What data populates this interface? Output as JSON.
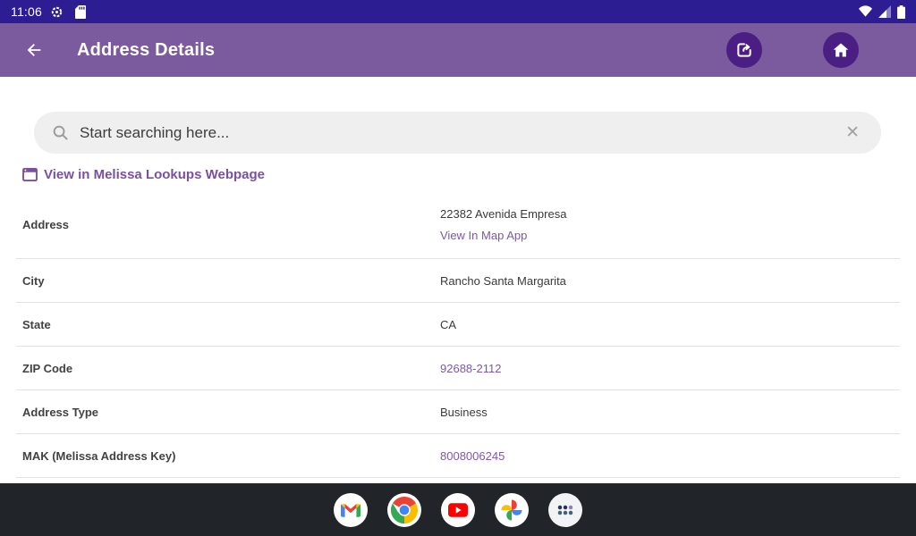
{
  "status_bar": {
    "time": "11:06",
    "left_icons": [
      "gear-icon",
      "sdcard-icon"
    ],
    "right_icons": [
      "wifi-icon",
      "cell-signal-icon",
      "battery-icon"
    ]
  },
  "app_bar": {
    "title": "Address Details",
    "actions": [
      "share",
      "home"
    ]
  },
  "search": {
    "placeholder": "Start searching here...",
    "value": ""
  },
  "webpage_link": {
    "label": "View in Melissa Lookups Webpage"
  },
  "details": {
    "rows": [
      {
        "label": "Address",
        "value": "22382 Avenida Empresa",
        "link": "View In Map App"
      },
      {
        "label": "City",
        "value": "Rancho Santa Margarita"
      },
      {
        "label": "State",
        "value": "CA"
      },
      {
        "label": "ZIP Code",
        "value": "92688-2112"
      },
      {
        "label": "Address Type",
        "value": "Business"
      },
      {
        "label": "MAK (Melissa Address Key)",
        "value": "8008006245"
      }
    ]
  },
  "dock": {
    "apps": [
      "Gmail",
      "Chrome",
      "YouTube",
      "Photos",
      "App Drawer"
    ]
  },
  "colors": {
    "status_bar": "#2c1d92",
    "app_bar": "#7b5a9e",
    "action_circle": "#4a1e82",
    "link_purple": "#7e57ab",
    "header_link_purple": "#7a50a0",
    "dock_bg": "#212529",
    "search_bg": "#efeff0",
    "separator": "#e3e3e3",
    "gmail_red": "#ea4335",
    "google_blue": "#4285f4",
    "google_green": "#34a853",
    "google_yellow": "#fbbc04",
    "youtube_red": "#ff0000"
  }
}
